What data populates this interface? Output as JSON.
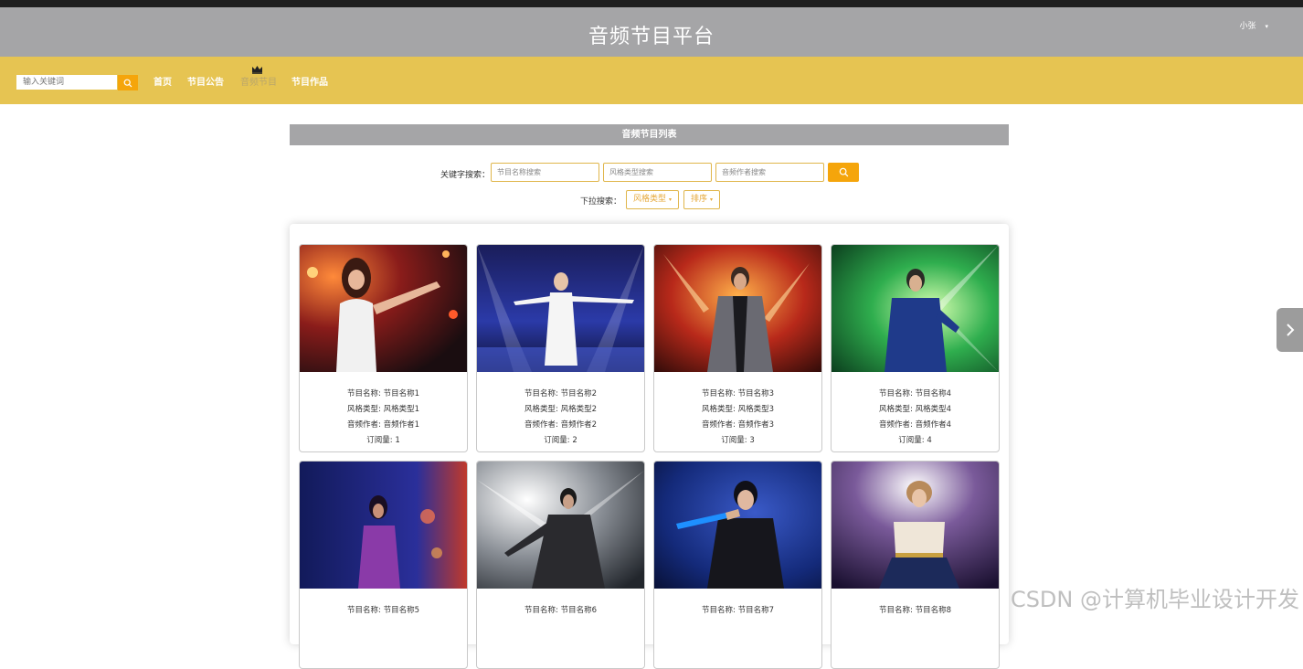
{
  "header": {
    "site_title": "音频节目平台",
    "user_name": "小张",
    "user_caret": "▾"
  },
  "navbar": {
    "search_placeholder": "输入关键词",
    "items": [
      {
        "label": "首页"
      },
      {
        "label": "节目公告"
      },
      {
        "label": "音频节目",
        "active": true
      },
      {
        "label": "节目作品"
      }
    ]
  },
  "section": {
    "banner_title": "音频节目列表"
  },
  "filters": {
    "keyword_label": "关键字搜索：",
    "name_placeholder": "节目名称搜索",
    "style_placeholder": "风格类型搜索",
    "author_placeholder": "音频作者搜索",
    "dropdown_label": "下拉搜索：",
    "style_dropdown": "风格类型",
    "sort_dropdown": "排序",
    "caret": "▾"
  },
  "cards": [
    {
      "name": "节目名称: 节目名称1",
      "style": "风格类型: 风格类型1",
      "author": "音频作者: 音频作者1",
      "subs": "订阅量: 1"
    },
    {
      "name": "节目名称: 节目名称2",
      "style": "风格类型: 风格类型2",
      "author": "音频作者: 音频作者2",
      "subs": "订阅量: 2"
    },
    {
      "name": "节目名称: 节目名称3",
      "style": "风格类型: 风格类型3",
      "author": "音频作者: 音频作者3",
      "subs": "订阅量: 3"
    },
    {
      "name": "节目名称: 节目名称4",
      "style": "风格类型: 风格类型4",
      "author": "音频作者: 音频作者4",
      "subs": "订阅量: 4"
    },
    {
      "name": "节目名称: 节目名称5",
      "style": "",
      "author": "",
      "subs": ""
    },
    {
      "name": "节目名称: 节目名称6",
      "style": "",
      "author": "",
      "subs": ""
    },
    {
      "name": "节目名称: 节目名称7",
      "style": "",
      "author": "",
      "subs": ""
    },
    {
      "name": "节目名称: 节目名称8",
      "style": "",
      "author": "",
      "subs": ""
    }
  ],
  "watermark": "CSDN @计算机毕业设计开发",
  "colors": {
    "header_bg": "#a5a5a7",
    "navbar_bg": "#e6c452",
    "accent": "#f5a50b"
  },
  "icons": {
    "search": "search-icon",
    "crown": "crown-icon",
    "next": "chevron-right-icon"
  }
}
